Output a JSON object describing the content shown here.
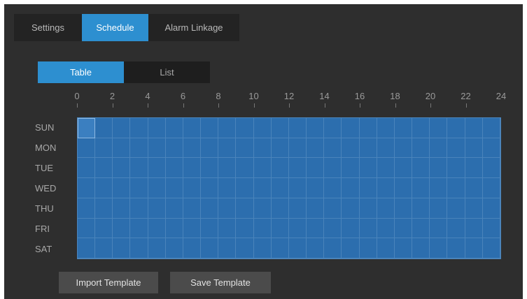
{
  "top_tabs": {
    "settings": "Settings",
    "schedule": "Schedule",
    "alarm_linkage": "Alarm Linkage",
    "active": "Schedule"
  },
  "view_tabs": {
    "table": "Table",
    "list": "List",
    "active": "Table"
  },
  "hours": [
    "0",
    "2",
    "4",
    "6",
    "8",
    "10",
    "12",
    "14",
    "16",
    "18",
    "20",
    "22",
    "24"
  ],
  "days": [
    "SUN",
    "MON",
    "TUE",
    "WED",
    "THU",
    "FRI",
    "SAT"
  ],
  "schedule": {
    "slots_per_day": 24,
    "all_slots_scheduled": true,
    "highlighted_cell": {
      "day": "SUN",
      "hour": 0
    }
  },
  "buttons": {
    "import_template": "Import Template",
    "save_template": "Save Template"
  },
  "colors": {
    "background": "#2e2e2e",
    "accent": "#2d8fd0",
    "scheduled_cell": "#2c6eae",
    "button": "#4b4b4b"
  }
}
